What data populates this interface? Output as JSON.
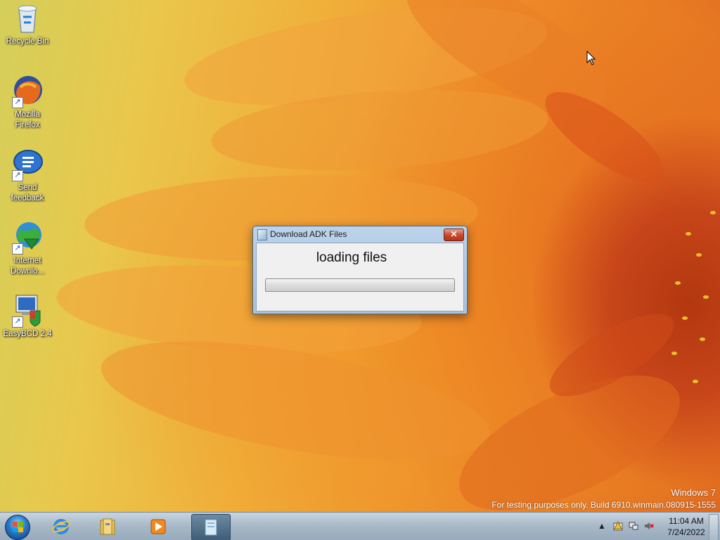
{
  "desktop": {
    "icons": [
      {
        "label": "Recycle Bin",
        "icon": "recycle-bin-icon"
      },
      {
        "label": "Mozilla Firefox",
        "icon": "firefox-icon"
      },
      {
        "label": "Send feedback",
        "icon": "feedback-icon"
      },
      {
        "label": "Internet Downlo...",
        "icon": "internet-download-manager-icon"
      },
      {
        "label": "EasyBCD 2.4",
        "icon": "easybcd-icon"
      }
    ]
  },
  "dialog": {
    "title": "Download ADK Files",
    "close_label": "✕",
    "message": "loading files",
    "progress": 0
  },
  "watermark": {
    "line1": "Windows  7",
    "line2": "For testing purposes only. Build 6910.winmain.080915-1555"
  },
  "taskbar": {
    "pinned": [
      {
        "name": "internet-explorer",
        "icon": "internet-explorer-icon"
      },
      {
        "name": "file-explorer",
        "icon": "folder-icon"
      },
      {
        "name": "media-player",
        "icon": "media-player-icon"
      },
      {
        "name": "download-adk-files",
        "icon": "app-window-icon",
        "active": true
      }
    ],
    "clock": {
      "time": "11:04 AM",
      "date": "7/24/2022"
    }
  }
}
